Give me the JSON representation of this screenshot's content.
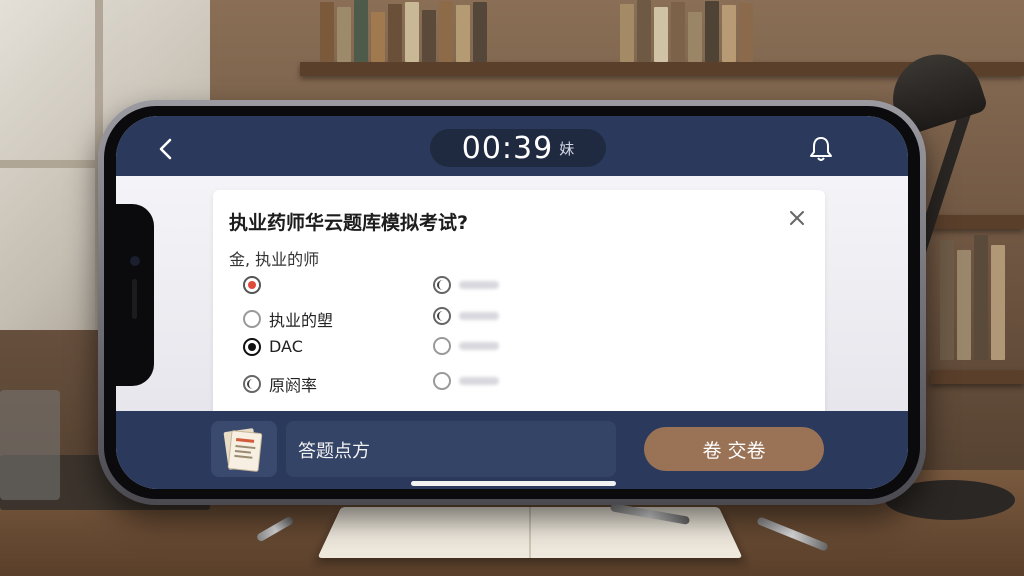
{
  "header": {
    "timer": "00:39",
    "timer_suffix": "妹",
    "back_icon": "chevron-left-icon",
    "bell_icon": "bell-icon"
  },
  "question": {
    "title": "执业药师华云题库模拟考试?",
    "subtitle": "金, 执业的师",
    "close_icon": "close-icon"
  },
  "options_left": [
    {
      "label": "",
      "state": "selected-red"
    },
    {
      "label": "执业的塱",
      "state": "half"
    },
    {
      "label": "DAC",
      "state": "selected"
    },
    {
      "label": "原阏率",
      "state": "half"
    }
  ],
  "footer": {
    "answer_sheet_label": "答题点方",
    "submit_label": "卷 交卷"
  },
  "colors": {
    "bar": "#2b3a5c",
    "submit": "#9a7356",
    "accent_red": "#e04a3a"
  }
}
